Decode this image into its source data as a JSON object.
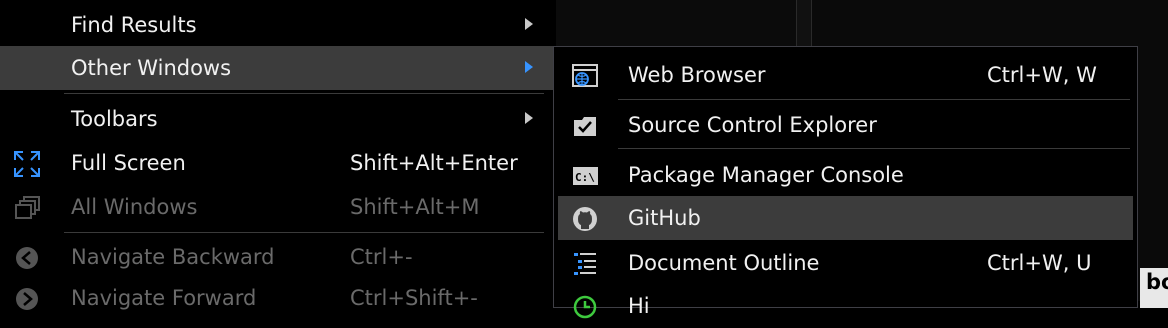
{
  "parent_menu": {
    "items": [
      {
        "label": "Find Results",
        "shortcut": "",
        "icon": "",
        "has_submenu": true
      },
      {
        "label": "Other Windows",
        "shortcut": "",
        "icon": "",
        "has_submenu": true,
        "highlighted": true
      },
      {
        "label": "Toolbars",
        "shortcut": "",
        "icon": "",
        "has_submenu": true
      },
      {
        "label": "Full Screen",
        "shortcut": "Shift+Alt+Enter",
        "icon": "fullscreen-expand-icon"
      },
      {
        "label": "All Windows",
        "shortcut": "Shift+Alt+M",
        "icon": "all-windows-icon",
        "disabled": true
      },
      {
        "label": "Navigate Backward",
        "shortcut": "Ctrl+-",
        "icon": "navigate-back-icon",
        "disabled": true
      },
      {
        "label": "Navigate Forward",
        "shortcut": "Ctrl+Shift+-",
        "icon": "navigate-forward-icon",
        "disabled": true
      }
    ]
  },
  "submenu": {
    "items": [
      {
        "label": "Web Browser",
        "shortcut": "Ctrl+W, W",
        "icon": "web-browser-icon"
      },
      {
        "label": "Source Control Explorer",
        "shortcut": "",
        "icon": "source-control-explorer-icon"
      },
      {
        "label": "Package Manager Console",
        "shortcut": "",
        "icon": "package-manager-console-icon"
      },
      {
        "label": "GitHub",
        "shortcut": "",
        "icon": "github-icon",
        "highlighted": true
      },
      {
        "label": "Document Outline",
        "shortcut": "Ctrl+W, U",
        "icon": "document-outline-icon"
      },
      {
        "label": "Hi",
        "shortcut": "",
        "icon": "history-icon"
      }
    ]
  },
  "background": {
    "editor_fragment": "bo"
  },
  "colors": {
    "highlight": "#3c3c3c",
    "accent_blue": "#3794ff",
    "disabled": "#6a6a6a",
    "menu_bg": "#000000"
  }
}
